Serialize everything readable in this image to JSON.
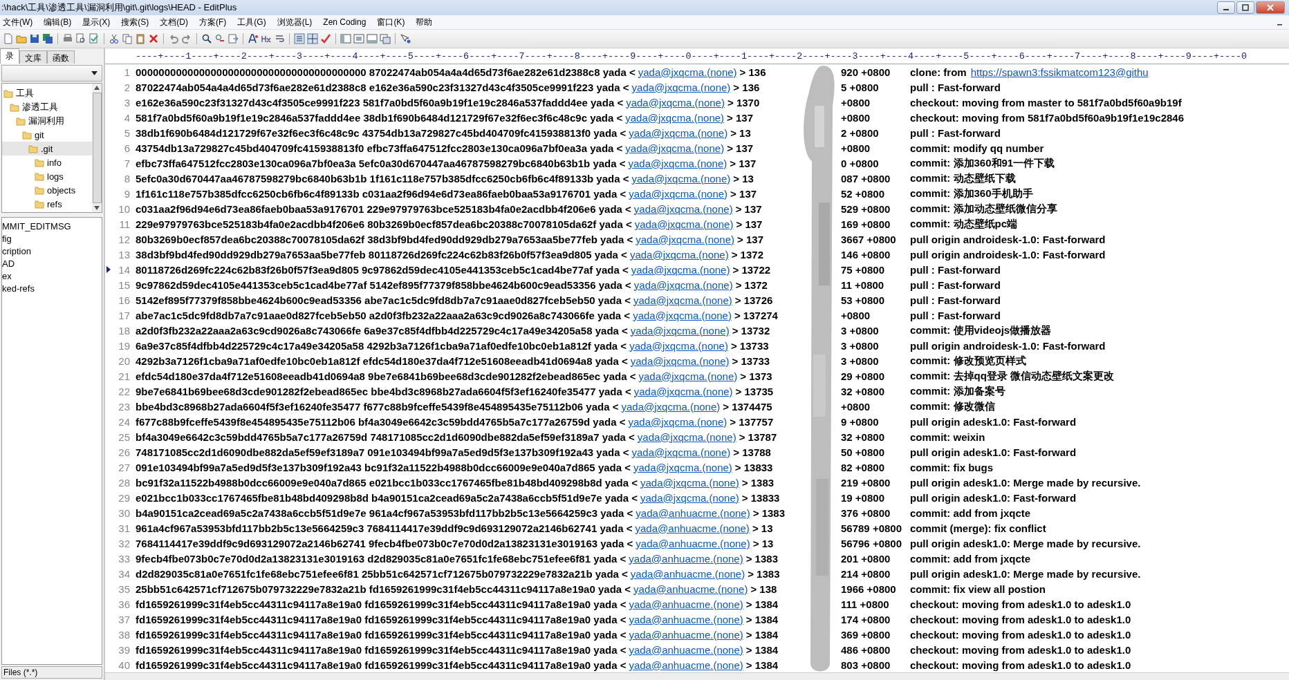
{
  "window": {
    "title": ":\\hack\\工具\\渗透工具\\漏洞利用\\git\\.git\\logs\\HEAD - EditPlus"
  },
  "menu": [
    "文件(W)",
    "编辑(B)",
    "显示(X)",
    "搜索(S)",
    "文档(D)",
    "方案(F)",
    "工具(G)",
    "浏览器(L)",
    "Zen Coding",
    "窗口(K)",
    "帮助"
  ],
  "sidebar": {
    "tabs": [
      {
        "label": "录",
        "selected": true
      },
      {
        "label": "文库",
        "selected": false
      },
      {
        "label": "函数",
        "selected": false
      }
    ],
    "tree": [
      {
        "label": "工具",
        "selected": false,
        "children": [
          {
            "label": "渗透工具",
            "selected": false,
            "children": [
              {
                "label": "漏洞利用",
                "selected": false,
                "children": [
                  {
                    "label": "git",
                    "selected": false,
                    "children": [
                      {
                        "label": ".git",
                        "selected": true,
                        "children": [
                          {
                            "label": "info",
                            "selected": false
                          },
                          {
                            "label": "logs",
                            "selected": false
                          },
                          {
                            "label": "objects",
                            "selected": false
                          },
                          {
                            "label": "refs",
                            "selected": false
                          }
                        ]
                      }
                    ]
                  }
                ]
              }
            ]
          }
        ]
      }
    ],
    "files": [
      "MMIT_EDITMSG",
      "fig",
      "cription",
      "AD",
      "ex",
      "ked-refs"
    ],
    "filter": "Files (*.*)"
  },
  "editor": {
    "ruler": "----+----1----+----2----+----3----+----4----+----5----+----6----+----7----+----8----+----9----+----0----+----1----+----2----+----3----+----4----+----5----+----6----+----7----+----8----+----9----+----0",
    "rows": [
      {
        "number": "1",
        "text": "0000000000000000000000000000000000000000 87022474ab054a4a4d65d73f6ae282e61d2388c8 yada <",
        "email": "yada@jxqcma.(none)",
        "time_start": "> 136",
        "time_end": "920 +0800",
        "message": "clone: from",
        "link": "https://spawn3:fssikmatcom123@githu",
        "current": false
      },
      {
        "number": "2",
        "text": "87022474ab054a4a4d65d73f6ae282e61d2388c8 e162e36a590c23f31327d43c4f3505ce9991f223 yada <",
        "email": "yada@jxqcma.(none)",
        "time_start": "> 136",
        "time_end": "5 +0800",
        "message": "pull : Fast-forward",
        "current": false
      },
      {
        "number": "3",
        "text": "e162e36a590c23f31327d43c4f3505ce9991f223 581f7a0bd5f60a9b19f1e19c2846a537faddd4ee yada <",
        "email": "yada@jxqcma.(none)",
        "time_start": "> 1370",
        "time_end": "+0800",
        "message": "checkout: moving from master to 581f7a0bd5f60a9b19f",
        "current": false
      },
      {
        "number": "4",
        "text": "581f7a0bd5f60a9b19f1e19c2846a537faddd4ee 38db1f690b6484d121729f67e32f6ec3f6c48c9c yada <",
        "email": "yada@jxqcma.(none)",
        "time_start": "> 137",
        "time_end": "+0800",
        "message": "checkout: moving from 581f7a0bd5f60a9b19f1e19c2846",
        "current": false
      },
      {
        "number": "5",
        "text": "38db1f690b6484d121729f67e32f6ec3f6c48c9c 43754db13a729827c45bd404709fc415938813f0 yada <",
        "email": "yada@jxqcma.(none)",
        "time_start": "> 13",
        "time_end": "2 +0800",
        "message": "pull : Fast-forward",
        "current": false
      },
      {
        "number": "6",
        "text": "43754db13a729827c45bd404709fc415938813f0 efbc73ffa647512fcc2803e130ca096a7bf0ea3a yada <",
        "email": "yada@jxqcma.(none)",
        "time_start": "> 137",
        "time_end": "+0800",
        "message": "commit: modify qq number",
        "current": false
      },
      {
        "number": "7",
        "text": "efbc73ffa647512fcc2803e130ca096a7bf0ea3a 5efc0a30d670447aa46787598279bc6840b63b1b yada <",
        "email": "yada@jxqcma.(none)",
        "time_start": "> 137",
        "time_end": "0 +0800",
        "message": "commit: 添加360和91一件下载",
        "current": false
      },
      {
        "number": "8",
        "text": "5efc0a30d670447aa46787598279bc6840b63b1b 1f161c118e757b385dfcc6250cb6fb6c4f89133b yada <",
        "email": "yada@jxqcma.(none)",
        "time_start": "> 13",
        "time_end": "087 +0800",
        "message": "commit: 动态壁纸下载",
        "current": false
      },
      {
        "number": "9",
        "text": "1f161c118e757b385dfcc6250cb6fb6c4f89133b c031aa2f96d94e6d73ea86faeb0baa53a9176701 yada <",
        "email": "yada@jxqcma.(none)",
        "time_start": "> 137",
        "time_end": "52 +0800",
        "message": "commit: 添加360手机助手",
        "current": false
      },
      {
        "number": "10",
        "text": "c031aa2f96d94e6d73ea86faeb0baa53a9176701 229e97979763bce525183b4fa0e2acdbb4f206e6 yada <",
        "email": "yada@jxqcma.(none)",
        "time_start": "> 137",
        "time_end": "529 +0800",
        "message": "commit: 添加动态壁纸微信分享",
        "current": false
      },
      {
        "number": "11",
        "text": "229e97979763bce525183b4fa0e2acdbb4f206e6 80b3269b0ecf857dea6bc20388c70078105da62f yada <",
        "email": "yada@jxqcma.(none)",
        "time_start": "> 137",
        "time_end": "169 +0800",
        "message": "commit: 动态壁纸pc端",
        "current": false
      },
      {
        "number": "12",
        "text": "80b3269b0ecf857dea6bc20388c70078105da62f 38d3bf9bd4fed90dd929db279a7653aa5be77feb yada <",
        "email": "yada@jxqcma.(none)",
        "time_start": "> 137",
        "time_end": "3667 +0800",
        "message": "pull origin androidesk-1.0: Fast-forward",
        "current": false
      },
      {
        "number": "13",
        "text": "38d3bf9bd4fed90dd929db279a7653aa5be77feb 80118726d269fc224c62b83f26b0f57f3ea9d805 yada <",
        "email": "yada@jxqcma.(none)",
        "time_start": "> 1372",
        "time_end": "146 +0800",
        "message": "pull origin androidesk-1.0: Fast-forward",
        "current": false
      },
      {
        "number": "14",
        "text": "80118726d269fc224c62b83f26b0f57f3ea9d805 9c97862d59dec4105e441353ceb5c1cad4be77af yada <",
        "email": "yada@jxqcma.(none)",
        "time_start": "> 13722",
        "time_end": "75 +0800",
        "message": "pull : Fast-forward",
        "current": true
      },
      {
        "number": "15",
        "text": "9c97862d59dec4105e441353ceb5c1cad4be77af 5142ef895f77379f858bbe4624b600c9ead53356 yada <",
        "email": "yada@jxqcma.(none)",
        "time_start": "> 1372",
        "time_end": "11 +0800",
        "message": "pull : Fast-forward",
        "current": false
      },
      {
        "number": "16",
        "text": "5142ef895f77379f858bbe4624b600c9ead53356 abe7ac1c5dc9fd8db7a7c91aae0d827fceb5eb50 yada <",
        "email": "yada@jxqcma.(none)",
        "time_start": "> 13726",
        "time_end": "53 +0800",
        "message": "pull : Fast-forward",
        "current": false
      },
      {
        "number": "17",
        "text": "abe7ac1c5dc9fd8db7a7c91aae0d827fceb5eb50 a2d0f3fb232a22aaa2a63c9cd9026a8c743066fe yada <",
        "email": "yada@jxqcma.(none)",
        "time_start": "> 137274",
        "time_end": "+0800",
        "message": "pull : Fast-forward",
        "current": false
      },
      {
        "number": "18",
        "text": "a2d0f3fb232a22aaa2a63c9cd9026a8c743066fe 6a9e37c85f4dfbb4d225729c4c17a49e34205a58 yada <",
        "email": "yada@jxqcma.(none)",
        "time_start": "> 13732",
        "time_end": "3 +0800",
        "message": "commit: 使用videojs做播放器",
        "current": false
      },
      {
        "number": "19",
        "text": "6a9e37c85f4dfbb4d225729c4c17a49e34205a58 4292b3a7126f1cba9a71af0edfe10bc0eb1a812f yada <",
        "email": "yada@jxqcma.(none)",
        "time_start": "> 13733",
        "time_end": "3 +0800",
        "message": "pull origin androidesk-1.0: Fast-forward",
        "current": false
      },
      {
        "number": "20",
        "text": "4292b3a7126f1cba9a71af0edfe10bc0eb1a812f efdc54d180e37da4f712e51608eeadb41d0694a8 yada <",
        "email": "yada@jxqcma.(none)",
        "time_start": "> 13733",
        "time_end": "3 +0800",
        "message": "commit: 修改预览页样式",
        "current": false
      },
      {
        "number": "21",
        "text": "efdc54d180e37da4f712e51608eeadb41d0694a8 9be7e6841b69bee68d3cde901282f2ebead865ec yada <",
        "email": "yada@jxqcma.(none)",
        "time_start": "> 1373",
        "time_end": "29 +0800",
        "message": "commit: 去掉qq登录 微信动态壁纸文案更改",
        "current": false
      },
      {
        "number": "22",
        "text": "9be7e6841b69bee68d3cde901282f2ebead865ec bbe4bd3c8968b27ada6604f5f3ef16240fe35477 yada <",
        "email": "yada@jxqcma.(none)",
        "time_start": "> 13735",
        "time_end": "32 +0800",
        "message": "commit: 添加备案号",
        "current": false
      },
      {
        "number": "23",
        "text": "bbe4bd3c8968b27ada6604f5f3ef16240fe35477 f677c88b9fceffe5439f8e454895435e75112b06 yada <",
        "email": "yada@jxqcma.(none)",
        "time_start": "> 1374475",
        "time_end": "+0800",
        "message": "commit: 修改微信",
        "current": false
      },
      {
        "number": "24",
        "text": "f677c88b9fceffe5439f8e454895435e75112b06 bf4a3049e6642c3c59bdd4765b5a7c177a26759d yada <",
        "email": "yada@jxqcma.(none)",
        "time_start": "> 137757",
        "time_end": "9 +0800",
        "message": "pull origin adesk1.0: Fast-forward",
        "current": false
      },
      {
        "number": "25",
        "text": "bf4a3049e6642c3c59bdd4765b5a7c177a26759d 748171085cc2d1d6090dbe882da5ef59ef3189a7 yada <",
        "email": "yada@jxqcma.(none)",
        "time_start": "> 13787",
        "time_end": "32 +0800",
        "message": "commit: weixin",
        "current": false
      },
      {
        "number": "26",
        "text": "748171085cc2d1d6090dbe882da5ef59ef3189a7 091e103494bf99a7a5ed9d5f3e137b309f192a43 yada <",
        "email": "yada@jxqcma.(none)",
        "time_start": "> 13788",
        "time_end": "50 +0800",
        "message": "pull origin adesk1.0: Fast-forward",
        "current": false
      },
      {
        "number": "27",
        "text": "091e103494bf99a7a5ed9d5f3e137b309f192a43 bc91f32a11522b4988b0dcc66009e9e040a7d865 yada <",
        "email": "yada@jxqcma.(none)",
        "time_start": "> 13833",
        "time_end": "82 +0800",
        "message": "commit: fix bugs",
        "current": false
      },
      {
        "number": "28",
        "text": "bc91f32a11522b4988b0dcc66009e9e040a7d865 e021bcc1b033cc1767465fbe81b48bd409298b8d yada <",
        "email": "yada@jxqcma.(none)",
        "time_start": "> 1383",
        "time_end": "219 +0800",
        "message": "pull origin adesk1.0: Merge made by recursive.",
        "current": false
      },
      {
        "number": "29",
        "text": "e021bcc1b033cc1767465fbe81b48bd409298b8d b4a90151ca2cead69a5c2a7438a6ccb5f51d9e7e yada <",
        "email": "yada@jxqcma.(none)",
        "time_start": "> 13833",
        "time_end": "19 +0800",
        "message": "pull origin adesk1.0: Fast-forward",
        "current": false
      },
      {
        "number": "30",
        "text": "b4a90151ca2cead69a5c2a7438a6ccb5f51d9e7e 961a4cf967a53953bfd117bb2b5c13e5664259c3 yada <",
        "email": "yada@anhuacme.(none)",
        "time_start": "> 1383",
        "time_end": "376 +0800",
        "message": "commit: add from jxqcte",
        "current": false
      },
      {
        "number": "31",
        "text": "961a4cf967a53953bfd117bb2b5c13e5664259c3 7684114417e39ddf9c9d693129072a2146b62741 yada <",
        "email": "yada@anhuacme.(none)",
        "time_start": "> 13",
        "time_end": "56789 +0800",
        "message": "commit (merge): fix conflict",
        "current": false
      },
      {
        "number": "32",
        "text": "7684114417e39ddf9c9d693129072a2146b62741 9fecb4fbe073b0c7e70d0d2a13823131e3019163 yada <",
        "email": "yada@anhuacme.(none)",
        "time_start": "> 13",
        "time_end": "56796 +0800",
        "message": "pull origin adesk1.0: Merge made by recursive.",
        "current": false
      },
      {
        "number": "33",
        "text": "9fecb4fbe073b0c7e70d0d2a13823131e3019163 d2d829035c81a0e7651fc1fe68ebc751efee6f81 yada <",
        "email": "yada@anhuacme.(none)",
        "time_start": "> 1383",
        "time_end": "201 +0800",
        "message": "commit: add from jxqcte",
        "current": false
      },
      {
        "number": "34",
        "text": "d2d829035c81a0e7651fc1fe68ebc751efee6f81 25bb51c642571cf712675b079732229e7832a21b yada <",
        "email": "yada@anhuacme.(none)",
        "time_start": "> 1383",
        "time_end": "214 +0800",
        "message": "pull origin adesk1.0: Merge made by recursive.",
        "current": false
      },
      {
        "number": "35",
        "text": "25bb51c642571cf712675b079732229e7832a21b fd1659261999c31f4eb5cc44311c94117a8e19a0 yada <",
        "email": "yada@anhuacme.(none)",
        "time_start": "> 138",
        "time_end": "1966 +0800",
        "message": "commit: fix view all postion",
        "current": false
      },
      {
        "number": "36",
        "text": "fd1659261999c31f4eb5cc44311c94117a8e19a0 fd1659261999c31f4eb5cc44311c94117a8e19a0 yada <",
        "email": "yada@anhuacme.(none)",
        "time_start": "> 1384",
        "time_end": "111 +0800",
        "message": "checkout: moving from adesk1.0 to adesk1.0",
        "current": false
      },
      {
        "number": "37",
        "text": "fd1659261999c31f4eb5cc44311c94117a8e19a0 fd1659261999c31f4eb5cc44311c94117a8e19a0 yada <",
        "email": "yada@anhuacme.(none)",
        "time_start": "> 1384",
        "time_end": "174 +0800",
        "message": "checkout: moving from adesk1.0 to adesk1.0",
        "current": false
      },
      {
        "number": "38",
        "text": "fd1659261999c31f4eb5cc44311c94117a8e19a0 fd1659261999c31f4eb5cc44311c94117a8e19a0 yada <",
        "email": "yada@anhuacme.(none)",
        "time_start": "> 1384",
        "time_end": "369 +0800",
        "message": "checkout: moving from adesk1.0 to adesk1.0",
        "current": false
      },
      {
        "number": "39",
        "text": "fd1659261999c31f4eb5cc44311c94117a8e19a0 fd1659261999c31f4eb5cc44311c94117a8e19a0 yada <",
        "email": "yada@anhuacme.(none)",
        "time_start": "> 1384",
        "time_end": "486 +0800",
        "message": "checkout: moving from adesk1.0 to adesk1.0",
        "current": false
      },
      {
        "number": "40",
        "text": "fd1659261999c31f4eb5cc44311c94117a8e19a0 fd1659261999c31f4eb5cc44311c94117a8e19a0 yada <",
        "email": "yada@anhuacme.(none)",
        "time_start": "> 1384",
        "time_end": "803 +0800",
        "message": "checkout: moving from adesk1.0 to adesk1.0",
        "current": false
      }
    ]
  }
}
